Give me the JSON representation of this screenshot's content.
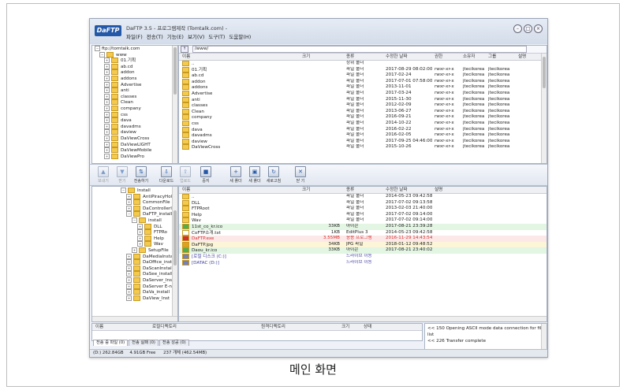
{
  "app": {
    "logo": "DaFTP",
    "title": "DaFTP 3.5 - 프로그램제작 (Tomtalk.com) -",
    "menu": [
      "파일(F)",
      "전송(T)",
      "기능(E)",
      "보기(V)",
      "도구(T)",
      "도움말(H)"
    ]
  },
  "caption": "메인 화면",
  "remote_tree": {
    "root": "ftp://tomtalk.com",
    "child": "www",
    "items": [
      "01.기획",
      "ab.cd",
      "addon",
      "addons",
      "Advertise",
      "anti",
      "classes",
      "Clean",
      "company",
      "css",
      "dava",
      "davadms",
      "daview",
      "DaViewCross",
      "DaViewLIGHT",
      "DaViewMobile",
      "DaViewPro"
    ]
  },
  "remote_path": "/www/",
  "remote_list": {
    "headers": [
      "이름",
      "크기",
      "종류",
      "수정한 날짜",
      "권한",
      "소유자",
      "그룹",
      "설명"
    ],
    "rows": [
      [
        "..",
        "",
        "상위 폴더",
        "",
        "",
        "",
        ""
      ],
      [
        "01.기획",
        "",
        "파일 폴더",
        "2017-08-29 08:02:00",
        "rwxr-xr-x",
        "jtecikorea",
        "jtecikorea"
      ],
      [
        "ab.cd",
        "",
        "파일 폴더",
        "2017-02-24",
        "rwxr-xr-x",
        "jtecikorea",
        "jtecikorea"
      ],
      [
        "addon",
        "",
        "파일 폴더",
        "2017-07-01 07:58:00",
        "rwxr-xr-x",
        "jtecikorea",
        "jtecikorea"
      ],
      [
        "addons",
        "",
        "파일 폴더",
        "2013-11-01",
        "rwxr-xr-x",
        "jtecikorea",
        "jtecikorea"
      ],
      [
        "Advertise",
        "",
        "파일 폴더",
        "2017-03-24",
        "rwxr-xr-x",
        "jtecikorea",
        "jtecikorea"
      ],
      [
        "anti",
        "",
        "파일 폴더",
        "2015-11-30",
        "rwxr-xr-x",
        "jtecikorea",
        "jtecikorea"
      ],
      [
        "classes",
        "",
        "파일 폴더",
        "2012-02-09",
        "rwxr-xr-x",
        "jtecikorea",
        "jtecikorea"
      ],
      [
        "Clean",
        "",
        "파일 폴더",
        "2013-06-27",
        "rwxr-xr-x",
        "jtecikorea",
        "jtecikorea"
      ],
      [
        "company",
        "",
        "파일 폴더",
        "2016-09-21",
        "rwxr-xr-x",
        "jtecikorea",
        "jtecikorea"
      ],
      [
        "css",
        "",
        "파일 폴더",
        "2014-10-22",
        "rwxr-xr-x",
        "jtecikorea",
        "jtecikorea"
      ],
      [
        "dava",
        "",
        "파일 폴더",
        "2016-02-22",
        "rwxr-xr-x",
        "jtecikorea",
        "jtecikorea"
      ],
      [
        "davadms",
        "",
        "파일 폴더",
        "2016-02-05",
        "rwxr-xr-x",
        "jtecikorea",
        "jtecikorea"
      ],
      [
        "daview",
        "",
        "파일 폴더",
        "2017-09-25 04:46:00",
        "rwxr-xr-x",
        "jtecikorea",
        "jtecikorea"
      ],
      [
        "DaViewCross",
        "",
        "파일 폴더",
        "2015-10-26",
        "rwxr-xr-x",
        "jtecikorea",
        "jtecikorea"
      ]
    ]
  },
  "toolbar": [
    {
      "label": "보내기",
      "glyph": "▲",
      "disabled": true
    },
    {
      "label": "받기",
      "glyph": "▼",
      "disabled": true
    },
    {
      "label": "전송하기",
      "glyph": "⇅",
      "disabled": false
    },
    {
      "label": "다운로드",
      "glyph": "⇩",
      "disabled": false
    },
    {
      "label": "업로드",
      "glyph": "⇧",
      "disabled": true
    },
    {
      "label": "중지",
      "glyph": "■",
      "disabled": false
    },
    {
      "label": "새 폴더",
      "glyph": "+",
      "disabled": false
    },
    {
      "label": "새 폴더",
      "glyph": "▣",
      "disabled": false
    },
    {
      "label": "새로고침",
      "glyph": "↻",
      "disabled": false
    },
    {
      "label": "닫 기",
      "glyph": "✕",
      "disabled": false
    }
  ],
  "local_tree": {
    "items": [
      {
        "label": "Install",
        "level": 0
      },
      {
        "label": "AntiPiracyHol",
        "level": 1
      },
      {
        "label": "CommonFile",
        "level": 1
      },
      {
        "label": "DaControllerI",
        "level": 1
      },
      {
        "label": "DaFTP_install",
        "level": 1
      },
      {
        "label": "install",
        "level": 2
      },
      {
        "label": "DLL",
        "level": 3
      },
      {
        "label": "FTPRo",
        "level": 3
      },
      {
        "label": "Help",
        "level": 3
      },
      {
        "label": "Wav",
        "level": 3
      },
      {
        "label": "SetupFile",
        "level": 2
      },
      {
        "label": "DaMediaInsta",
        "level": 1
      },
      {
        "label": "DaOffice_inst",
        "level": 1
      },
      {
        "label": "DaScanInstall",
        "level": 1
      },
      {
        "label": "DaSee_install",
        "level": 1
      },
      {
        "label": "DaServer_Inst",
        "level": 1
      },
      {
        "label": "DaServer E-n",
        "level": 1
      },
      {
        "label": "DaVa_install",
        "level": 1
      },
      {
        "label": "DaView_Inst",
        "level": 1
      }
    ]
  },
  "local_list": {
    "headers": [
      "이름",
      "크기",
      "종류",
      "수정한 날짜",
      "설명"
    ],
    "rows": [
      {
        "cells": [
          "..",
          "",
          "파일 폴더",
          "2014-05-23 09:42:58"
        ],
        "kind": "folder",
        "color": ""
      },
      {
        "cells": [
          "DLL",
          "",
          "파일 폴더",
          "2017-07-02 09:13:58"
        ],
        "kind": "folder",
        "color": ""
      },
      {
        "cells": [
          "FTPRoot",
          "",
          "파일 폴더",
          "2013-02-03 21:40:00"
        ],
        "kind": "folder",
        "color": ""
      },
      {
        "cells": [
          "Help",
          "",
          "파일 폴더",
          "2017-07-02 09:14:00"
        ],
        "kind": "folder",
        "color": ""
      },
      {
        "cells": [
          "Wav",
          "",
          "파일 폴더",
          "2017-07-02 09:14:00"
        ],
        "kind": "folder",
        "color": ""
      },
      {
        "cells": [
          "11st_co_kr.ico",
          "33KB",
          "아이콘",
          "2017-08-21 23:39:28"
        ],
        "kind": "ico",
        "color": "#e3f5e3"
      },
      {
        "cells": [
          "CoFTP소개.txt",
          "1KB",
          "EditPlus 3",
          "2014-05-23 09:42:58"
        ],
        "kind": "txt",
        "color": ""
      },
      {
        "cells": [
          "DaFTP.exe",
          "3.55MB",
          "응용 프로그램",
          "2016-11-29 14:43:54"
        ],
        "kind": "exe",
        "color": "#fde8e8"
      },
      {
        "cells": [
          "DaFTP.jpg",
          "34KB",
          "JPG 파일",
          "2018-01-12 09:48:52"
        ],
        "kind": "jpg",
        "color": "#fdf5d8"
      },
      {
        "cells": [
          "Daou_kr.ico",
          "33KB",
          "아이콘",
          "2017-08-21 23:40:02"
        ],
        "kind": "ico",
        "color": "#e3f5e3"
      },
      {
        "cells": [
          "[로컬 디스크 (C:)]",
          "",
          "드라이브 이동",
          ""
        ],
        "kind": "drive",
        "color": ""
      },
      {
        "cells": [
          "[DATAC (D:)]",
          "",
          "드라이브 이동",
          ""
        ],
        "kind": "drive",
        "color": ""
      }
    ]
  },
  "queue": {
    "headers": [
      "이름",
      "로컬디렉토리",
      "원격디렉토리",
      "크기",
      "상태"
    ]
  },
  "log": [
    "<< 150 Opening ASCII mode data connection for file list",
    "<< 226 Transfer complete"
  ],
  "tabs": [
    "전송 중 파일 (0)",
    "전송 실패 (0)",
    "전송 성공 (0)"
  ],
  "status": {
    "drive": "(D:) 262.84GB",
    "free": "4.91GB Free",
    "items": "237 개체 (462.54MB)"
  },
  "colors": {
    "accent": "#2458a8",
    "folder": "#f3c94e",
    "exe_text": "#d03030",
    "drive_text": "#4040a0"
  }
}
